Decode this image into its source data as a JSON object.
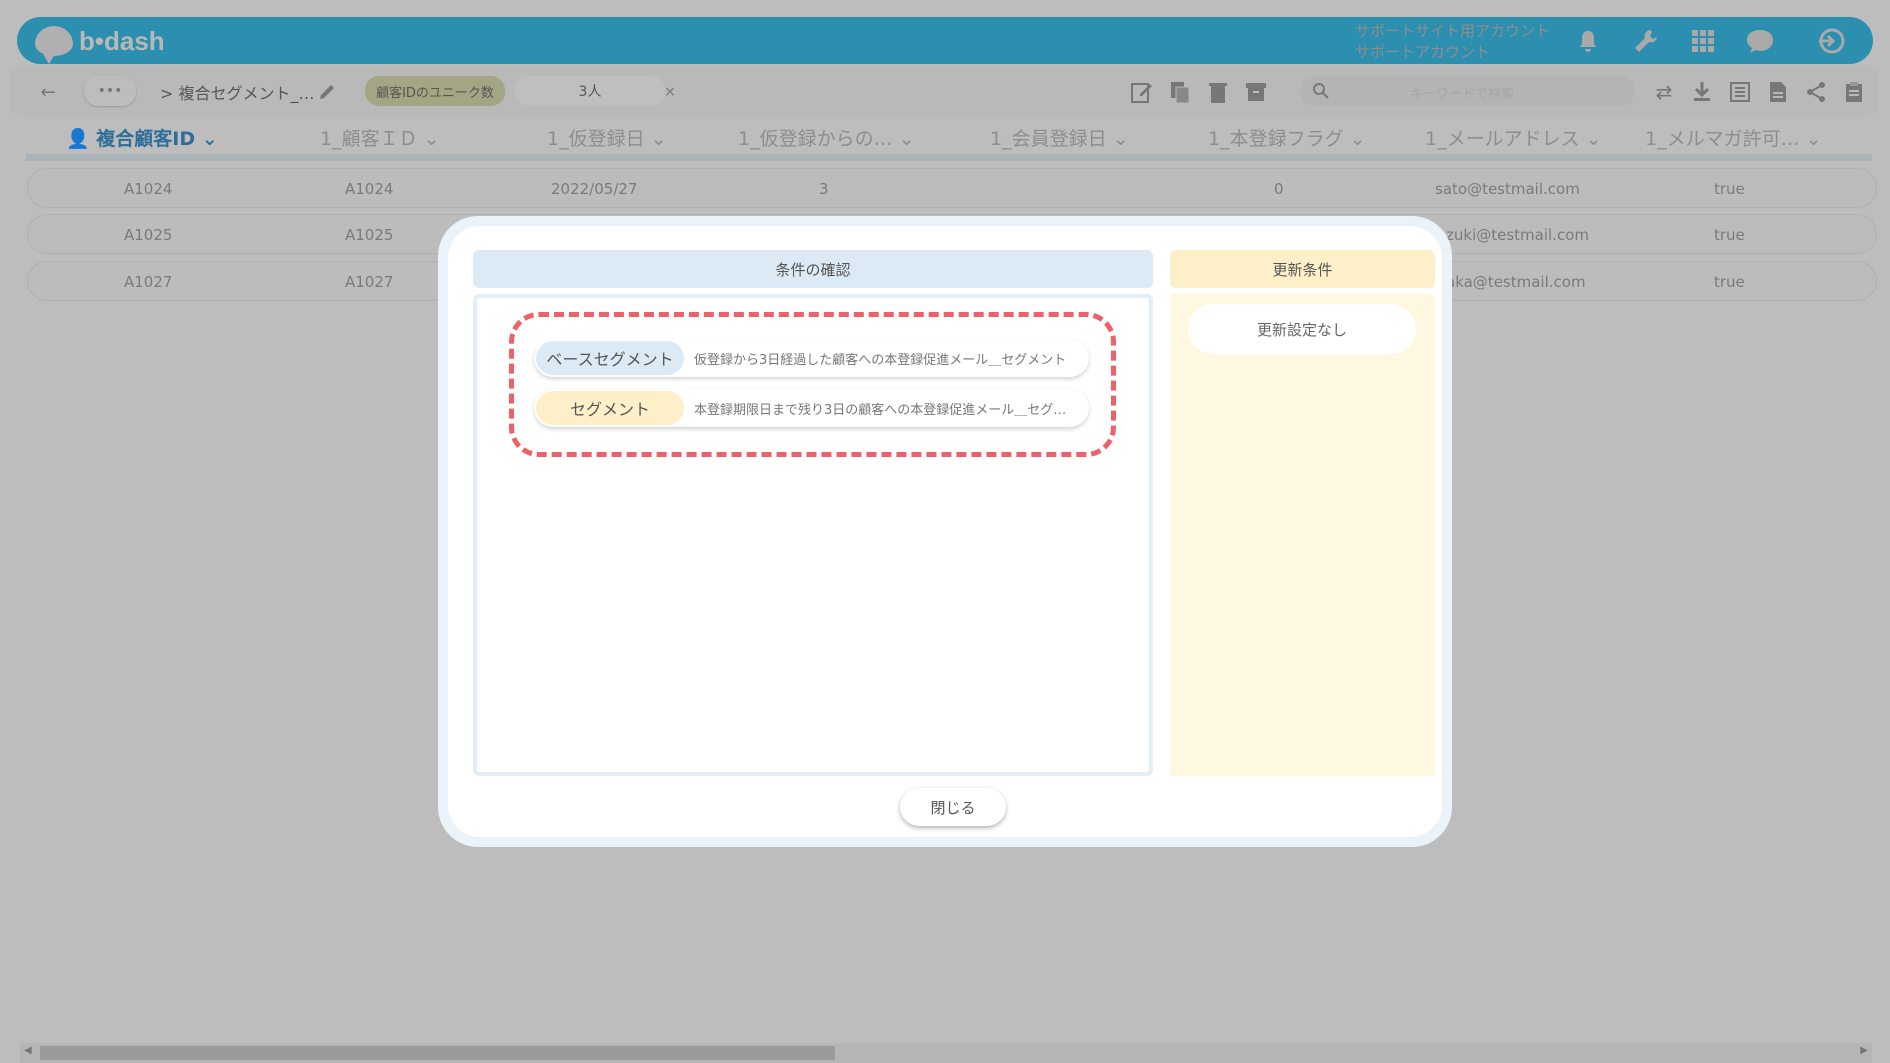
{
  "header": {
    "logo_text": "b•dash",
    "account_line1": "サポートサイト用アカウント",
    "account_line2": "サポートアカウント"
  },
  "toolbar": {
    "more_label": "•••",
    "breadcrumb": "> 複合セグメント_…",
    "unique_chip": "顧客IDのユニーク数",
    "count_chip": "3人",
    "search_placeholder": "キーワードで検索"
  },
  "table": {
    "columns": [
      "複合顧客ID",
      "1_顧客ＩＤ",
      "1_仮登録日",
      "1_仮登録からの…",
      "1_会員登録日",
      "1_本登録フラグ",
      "1_メールアドレス",
      "1_メルマガ許可…"
    ],
    "rows": [
      {
        "c1": "A1024",
        "c2": "A1024",
        "c3": "2022/05/27",
        "c4": "3",
        "c5": "",
        "c6": "0",
        "c7": "sato@testmail.com",
        "c8": "true"
      },
      {
        "c1": "A1025",
        "c2": "A1025",
        "c3": "",
        "c4": "",
        "c5": "",
        "c6": "",
        "c7": "zuki@testmail.com",
        "c8": "true"
      },
      {
        "c1": "A1027",
        "c2": "A1027",
        "c3": "",
        "c4": "",
        "c5": "",
        "c6": "",
        "c7": "aka@testmail.com",
        "c8": "true"
      }
    ]
  },
  "modal": {
    "conditions_title": "条件の確認",
    "update_title": "更新条件",
    "base_segment_label": "ベースセグメント",
    "base_segment_value": "仮登録から3日経過した顧客への本登録促進メール＿セグメント",
    "segment_label": "セグメント",
    "segment_value": "本登録期限日まで残り3日の顧客への本登録促進メール＿セグ…",
    "no_update": "更新設定なし",
    "close_label": "閉じる"
  },
  "colors": {
    "header": "#2d8fb0",
    "highlight_dash": "#ef6068",
    "base_segment": "#dbeaf4",
    "segment": "#fdf0c9"
  }
}
